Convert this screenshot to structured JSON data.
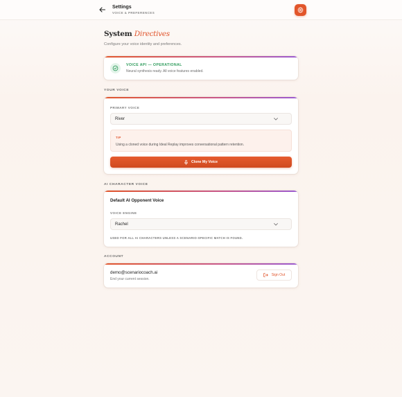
{
  "header": {
    "title": "Settings",
    "subtitle": "VOICE & PREFERENCES",
    "back_icon": "arrow-left-icon",
    "settings_icon": "gear-icon"
  },
  "page": {
    "title_plain": "System",
    "title_accent": "Directives",
    "description": "Configure your voice identity and preferences."
  },
  "status": {
    "title": "VOICE API — OPERATIONAL",
    "text": "Neural synthesis ready. All voice features enabled.",
    "icon": "check-circle-icon",
    "color": "#2c9a5a"
  },
  "your_voice": {
    "section_label": "YOUR VOICE",
    "field_label": "PRIMARY VOICE",
    "selected": "River",
    "tip_label": "TIP",
    "tip_text": "Using a cloned voice during Ideal Replay improves conversational pattern retention.",
    "clone_button": "Clone My Voice",
    "mic_icon": "microphone-icon"
  },
  "ai_voice": {
    "section_label": "AI CHARACTER VOICE",
    "heading": "Default AI Opponent Voice",
    "field_label": "VOICE ENGINE",
    "selected": "Rachel",
    "note": "USED FOR ALL AI CHARACTERS UNLESS A SCENARIO-SPECIFIC MATCH IS FOUND."
  },
  "account": {
    "section_label": "ACCOUNT",
    "email": "demo@scenariocoach.ai",
    "session_text": "End your current session.",
    "signout_button": "Sign Out",
    "signout_icon": "sign-out-icon"
  },
  "colors": {
    "accent": "#e2562b",
    "gradient_end": "#9b5bd1"
  }
}
